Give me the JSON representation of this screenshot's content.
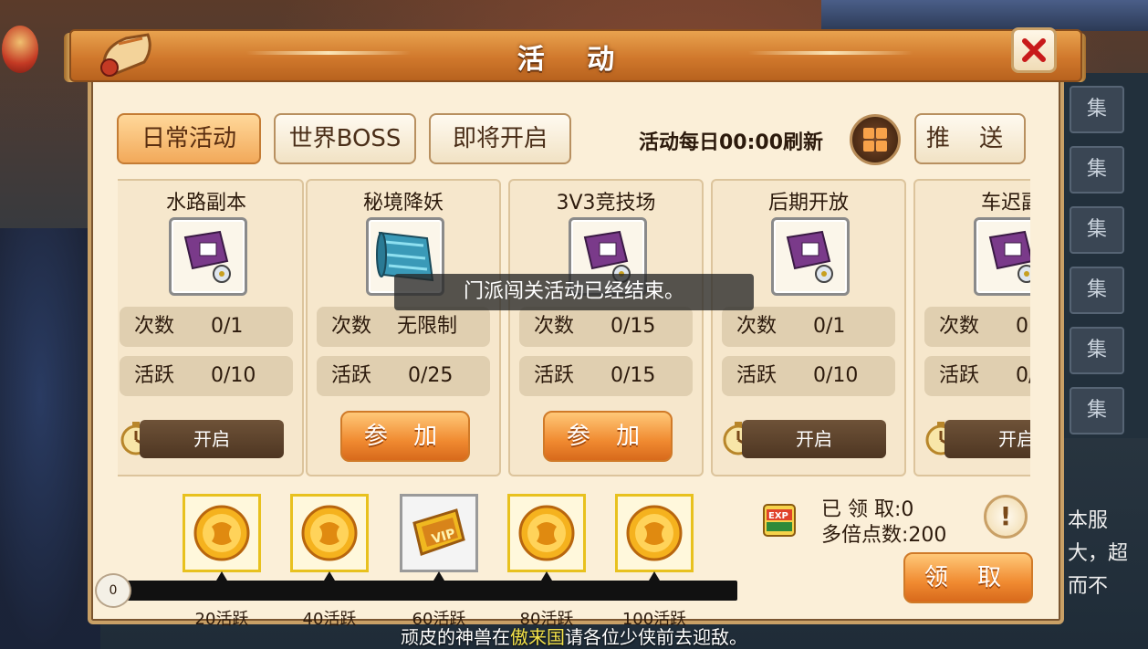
{
  "dialog": {
    "title": "活 动",
    "close_icon": "close-icon"
  },
  "tabs": [
    {
      "label": "日常活动",
      "active": true
    },
    {
      "label": "世界BOSS",
      "active": false
    },
    {
      "label": "即将开启",
      "active": false
    }
  ],
  "header_right": {
    "refresh_text": "活动每日00:00刷新",
    "grid_icon": "grid-icon",
    "push_label": "推 送"
  },
  "activities": [
    {
      "name": "水路副本",
      "icon": "scroll-icon",
      "count_label": "次数",
      "count_value": "0/1",
      "active_label": "活跃",
      "active_value": "0/10",
      "action": "开启",
      "action_type": "open"
    },
    {
      "name": "秘境降妖",
      "icon": "map-icon",
      "count_label": "次数",
      "count_value": "无限制",
      "active_label": "活跃",
      "active_value": "0/25",
      "action": "参 加",
      "action_type": "join"
    },
    {
      "name": "3V3竞技场",
      "icon": "scroll-icon",
      "count_label": "次数",
      "count_value": "0/15",
      "active_label": "活跃",
      "active_value": "0/15",
      "action": "参 加",
      "action_type": "join"
    },
    {
      "name": "后期开放",
      "icon": "scroll-icon",
      "count_label": "次数",
      "count_value": "0/1",
      "active_label": "活跃",
      "active_value": "0/10",
      "action": "开启",
      "action_type": "open"
    },
    {
      "name": "车迟副",
      "icon": "scroll-icon",
      "count_label": "次数",
      "count_value": "0",
      "active_label": "活跃",
      "active_value": "0/",
      "action": "开启",
      "action_type": "open"
    }
  ],
  "toast": "门派闯关活动已经结束。",
  "rewards": {
    "start": "0",
    "progress_fraction": 0,
    "milestones": [
      {
        "label": "20活跃",
        "icon": "coin-icon"
      },
      {
        "label": "40活跃",
        "icon": "coin-icon"
      },
      {
        "label": "60活跃",
        "icon": "vip-ticket-icon"
      },
      {
        "label": "80活跃",
        "icon": "coin-icon"
      },
      {
        "label": "100活跃",
        "icon": "coin-icon"
      }
    ],
    "claimed_label": "已 领 取:",
    "claimed_value": "0",
    "multiplier_label": "多倍点数:",
    "multiplier_value": "200",
    "info_label": "!",
    "claim_label": "领 取"
  },
  "side_text": [
    "本服",
    "大，超",
    "而不"
  ],
  "broadcast": {
    "before": "顽皮的神兽在",
    "highlight": "傲来国",
    "after": "请各位少侠前去迎敌。"
  },
  "colors": {
    "accent_orange": "#f08a30",
    "tab_active": "#f2a95a",
    "panel_bg": "#fbefd8",
    "highlight_yellow": "#f4e34a",
    "reward_border": "#e8c11e"
  }
}
